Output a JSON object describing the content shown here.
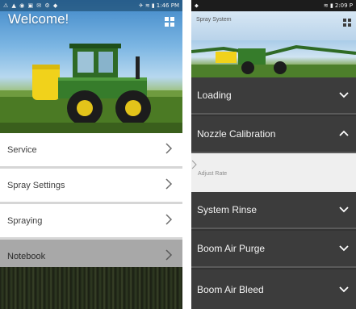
{
  "left_screen": {
    "status": {
      "icons": "⚠ ▲ ◉ ▣ ✉ ⚙ ◆",
      "signal": "✈ ≋ ▮",
      "time": "1:46 PM"
    },
    "welcome_title": "Welcome!",
    "menu_items": [
      {
        "label": "Service",
        "icon": "chevron-right-icon"
      },
      {
        "label": "Spray Settings",
        "icon": "chevron-right-icon"
      },
      {
        "label": "Spraying",
        "icon": "chevron-right-icon"
      },
      {
        "label": "Notebook",
        "icon": "chevron-right-icon"
      }
    ],
    "active_item": "Notebook"
  },
  "right_screen": {
    "status": {
      "icons": "⬥",
      "signal": "≋ ▮",
      "time": "2:09 P"
    },
    "title": "Spray System",
    "sections": [
      {
        "label": "Loading",
        "expanded": false,
        "icon": "chevron-down-icon"
      },
      {
        "label": "Nozzle Calibration",
        "expanded": true,
        "icon": "chevron-up-icon"
      },
      {
        "label": "System Rinse",
        "expanded": false,
        "icon": "chevron-down-icon"
      },
      {
        "label": "Boom Air Purge",
        "expanded": false,
        "icon": "chevron-down-icon"
      },
      {
        "label": "Boom Air Bleed",
        "expanded": false,
        "icon": "chevron-down-icon"
      }
    ],
    "subitem": "Adjust Rate"
  },
  "colors": {
    "sky": "#3f87c8",
    "john_deere_green": "#367c2b",
    "john_deere_yellow": "#ffde00",
    "menu_bg": "#ffffff",
    "menu_active_bg": "#a8a8a8",
    "section_bg": "#3c3c3c",
    "subrow_bg": "#efefef"
  }
}
